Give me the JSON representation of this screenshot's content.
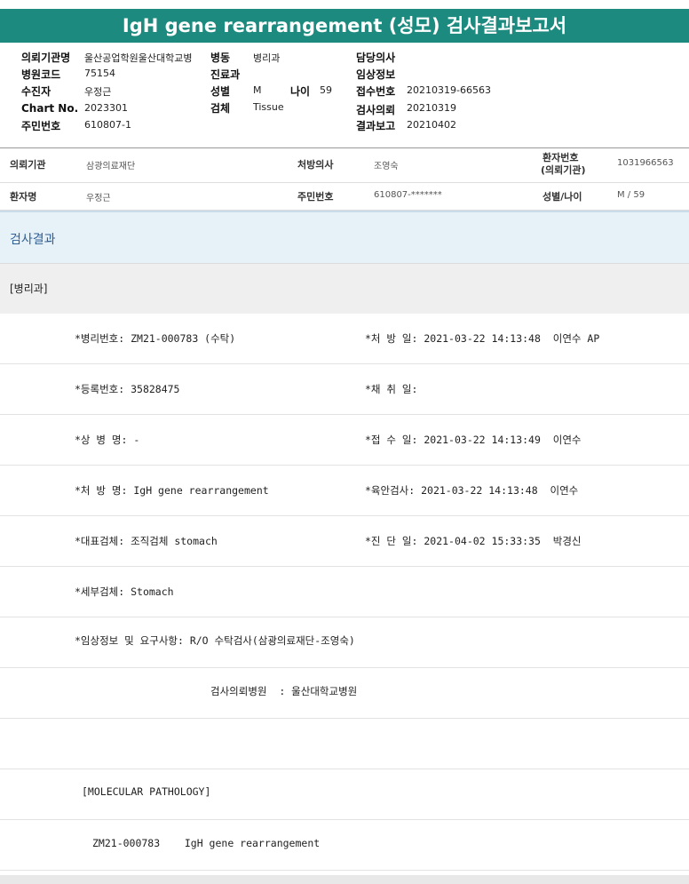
{
  "title": "IgH gene rearrangement (성모) 검사결과보고서",
  "header": {
    "org_label": "의뢰기관명",
    "org_value": "울산공업학원울산대학교병",
    "ward_label": "병동",
    "ward_value": "병리과",
    "doctor_label": "담당의사",
    "doctor_value": "",
    "code_label": "병원코드",
    "code_value": "75154",
    "dept_label": "진료과",
    "dept_value": "",
    "clinical_label": "임상정보",
    "clinical_value": "",
    "collector_label": "수진자",
    "collector_value": "우정근",
    "sex_label": "성별",
    "sex_value": "M",
    "age_label": "나이",
    "age_value": "59",
    "receipt_label": "접수번호",
    "receipt_value": "20210319-66563",
    "chart_label": "Chart No.",
    "chart_value": "2023301",
    "specimen_label": "검체",
    "specimen_value": "Tissue",
    "request_label": "검사의뢰",
    "request_value": "20210319",
    "rrn_label": "주민번호",
    "rrn_value": "610807-1",
    "report_label": "결과보고",
    "report_value": "20210402"
  },
  "info": {
    "inst_label": "의뢰기관",
    "inst_value": "삼광의료재단",
    "presc_label": "처방의사",
    "presc_value": "조영숙",
    "patno_label1": "환자번호",
    "patno_label2": "(의뢰기관)",
    "patno_value": "1031966563",
    "patient_label": "환자명",
    "patient_value": "우정근",
    "rrn_label": "주민번호",
    "rrn_value": "610807-*******",
    "sexage_label": "성별/나이",
    "sexage_value": "M / 59"
  },
  "results": {
    "section_title": "검사결과",
    "dept_tag": "[병리과]",
    "rows": [
      {
        "left": "*병리번호: ZM21-000783 (수탁)",
        "right": "*처 방 일: 2021-03-22 14:13:48  이연수 AP"
      },
      {
        "left": "*등록번호: 35828475",
        "right": "*채 취 일:"
      },
      {
        "left": "*상 병 명: -",
        "right": "*접 수 일: 2021-03-22 14:13:49  이연수"
      },
      {
        "left": "*처 방 명: IgH gene rearrangement",
        "right": "*육안검사: 2021-03-22 14:13:48  이연수"
      },
      {
        "left": "*대표검체: 조직검체 stomach",
        "right": "*진 단 일: 2021-04-02 15:33:35  박경신"
      },
      {
        "left": "*세부검체: Stomach",
        "right": ""
      },
      {
        "left": "*임상정보 및 요구사항: R/O 수탁검사(삼광의료재단-조영숙)",
        "right": ""
      },
      {
        "left": "검사의뢰병원  : 울산대학교병원",
        "right": ""
      },
      {
        "left": "",
        "right": ""
      },
      {
        "left": "[MOLECULAR PATHOLOGY]",
        "right": ""
      },
      {
        "left": "ZM21-000783    IgH gene rearrangement",
        "right": ""
      }
    ]
  }
}
